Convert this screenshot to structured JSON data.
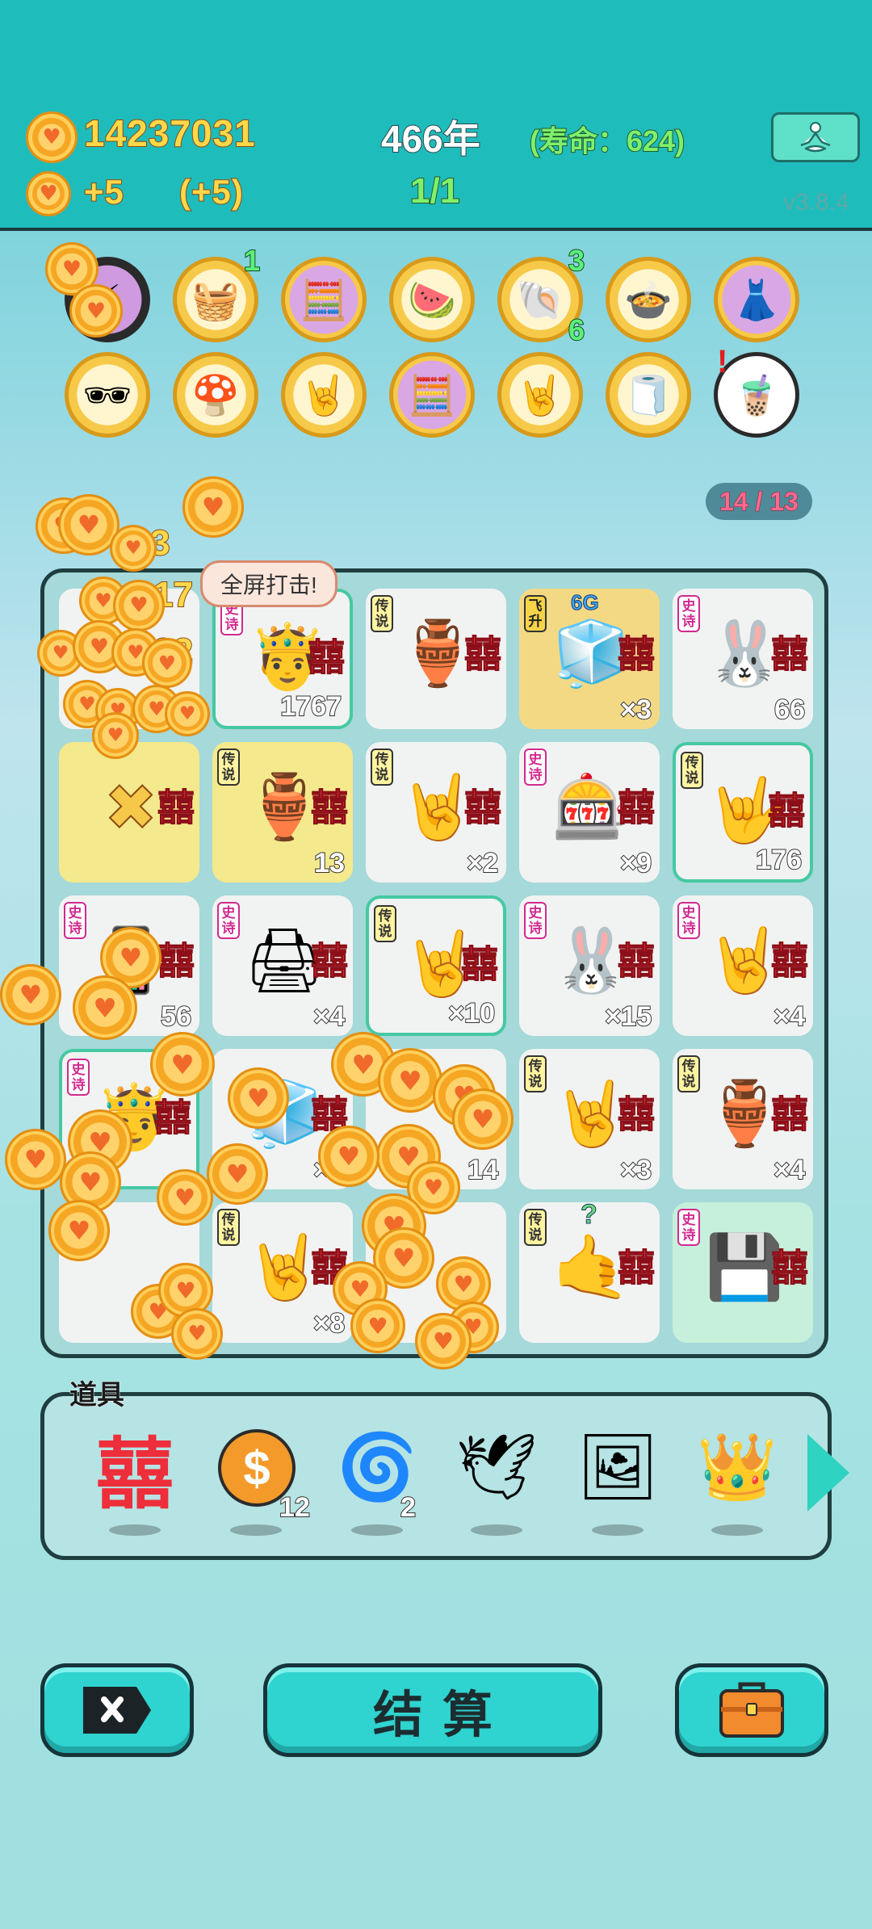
{
  "header": {
    "coins": "14237031",
    "year": "466年",
    "lifespan": "(寿命：624)",
    "income": "+5",
    "income_bonus": "(+5)",
    "round": "1/1",
    "version": "v3.8.4",
    "meditate_icon": "meditate-person-icon"
  },
  "relics": {
    "row1": [
      {
        "name": "lightning-icon",
        "glyph": "⚡"
      },
      {
        "name": "fruit-basket-icon",
        "glyph": "🧺",
        "count": "1"
      },
      {
        "name": "math-head-icon",
        "glyph": "🧮"
      },
      {
        "name": "fruit-plate-icon",
        "glyph": "🍉"
      },
      {
        "name": "shell-icon",
        "glyph": "🐚",
        "count": "3",
        "count2": "6"
      },
      {
        "name": "duck-pot-icon",
        "glyph": "🍲"
      },
      {
        "name": "skirt-icon",
        "glyph": "👗"
      }
    ],
    "row2": [
      {
        "name": "sunglasses-egg-icon",
        "glyph": "🕶"
      },
      {
        "name": "mushroom-cloud-icon",
        "glyph": "🍄"
      },
      {
        "name": "rock-hand-icon",
        "glyph": "🤘"
      },
      {
        "name": "math-head-icon",
        "glyph": "🧮"
      },
      {
        "name": "rock-hand-icon",
        "glyph": "🤘"
      },
      {
        "name": "tissue-box-icon",
        "glyph": "🧻"
      },
      {
        "name": "bubble-tea-icon",
        "glyph": "🧋",
        "alert": "!"
      }
    ]
  },
  "page_indicator": "14 / 13",
  "board": {
    "bubble": "全屏打击!",
    "float_numbers": [
      "3",
      "17",
      "22"
    ],
    "tags": {
      "shi": "史诗",
      "chuan": "传说",
      "fei": "飞升"
    },
    "xi": "囍",
    "cells": [
      {
        "name": "cell-coin-pile",
        "bg": "",
        "tag": "",
        "glyph": "",
        "count": ""
      },
      {
        "name": "cell-king-head",
        "bg": "glow",
        "tag": "shi",
        "glyph": "🤴",
        "count": "1767"
      },
      {
        "name": "cell-green-vase",
        "bg": "",
        "tag": "chuan",
        "glyph": "🏺",
        "count": ""
      },
      {
        "name": "cell-fridge",
        "bg": "gold",
        "tag": "fei",
        "glyph": "🧊",
        "count": "×3",
        "extra": "6G"
      },
      {
        "name": "cell-rabbit-house",
        "bg": "",
        "tag": "shi",
        "glyph": "🐰",
        "count": "66"
      },
      {
        "name": "cell-empty-yellow",
        "bg": "yellow",
        "tag": "",
        "glyph": "✖",
        "count": ""
      },
      {
        "name": "cell-green-vase",
        "bg": "yellow",
        "tag": "chuan",
        "glyph": "🏺",
        "count": "13"
      },
      {
        "name": "cell-yellow-hand",
        "bg": "",
        "tag": "chuan",
        "glyph": "🤘",
        "count": "×2"
      },
      {
        "name": "cell-gacha-machine",
        "bg": "",
        "tag": "shi",
        "glyph": "🎰",
        "count": "×9"
      },
      {
        "name": "cell-yellow-hand",
        "bg": "glow",
        "tag": "chuan",
        "glyph": "🤟",
        "count": "176"
      },
      {
        "name": "cell-phone",
        "bg": "",
        "tag": "shi",
        "glyph": "📱",
        "count": "56"
      },
      {
        "name": "cell-printer",
        "bg": "",
        "tag": "shi",
        "glyph": "🖨",
        "count": "×4"
      },
      {
        "name": "cell-crowned-hand",
        "bg": "glow",
        "tag": "chuan",
        "glyph": "🤘",
        "count": "×10"
      },
      {
        "name": "cell-rabbit-house",
        "bg": "",
        "tag": "shi",
        "glyph": "🐰",
        "count": "×15"
      },
      {
        "name": "cell-grey-hand",
        "bg": "",
        "tag": "shi",
        "glyph": "🤘",
        "count": "×4"
      },
      {
        "name": "cell-king-head",
        "bg": "glow",
        "tag": "shi",
        "glyph": "🤴",
        "count": ""
      },
      {
        "name": "cell-fridge",
        "bg": "",
        "tag": "",
        "glyph": "🧊",
        "count": "×5"
      },
      {
        "name": "cell-coin-pile",
        "bg": "",
        "tag": "",
        "glyph": "",
        "count": "14"
      },
      {
        "name": "cell-crowned-hand",
        "bg": "",
        "tag": "chuan",
        "glyph": "🤘",
        "count": "×3"
      },
      {
        "name": "cell-green-vase",
        "bg": "",
        "tag": "chuan",
        "glyph": "🏺",
        "count": "×4"
      },
      {
        "name": "cell-empty",
        "bg": "",
        "tag": "",
        "glyph": "",
        "count": ""
      },
      {
        "name": "cell-crowned-hand-big",
        "bg": "",
        "tag": "chuan",
        "glyph": "🤘",
        "count": "×8"
      },
      {
        "name": "cell-coin-pile",
        "bg": "",
        "tag": "",
        "glyph": "",
        "count": ""
      },
      {
        "name": "cell-yellow-hand-question",
        "bg": "",
        "tag": "chuan",
        "glyph": "🤙",
        "count": "",
        "extra": "?"
      },
      {
        "name": "cell-gpu",
        "bg": "mint",
        "tag": "shi",
        "glyph": "💾",
        "count": ""
      }
    ]
  },
  "props": {
    "label": "道具",
    "items": [
      {
        "name": "xi-character-icon",
        "glyph": "囍",
        "count": ""
      },
      {
        "name": "dollar-coin-icon",
        "glyph": "$",
        "count": "12"
      },
      {
        "name": "black-hole-icon",
        "glyph": "🌀",
        "count": "2"
      },
      {
        "name": "white-bird-icon",
        "glyph": "🕊",
        "count": ""
      },
      {
        "name": "picture-frame-icon",
        "glyph": "🖼",
        "count": ""
      },
      {
        "name": "crown-icon",
        "glyph": "👑",
        "count": ""
      }
    ]
  },
  "buttons": {
    "close_icon": "close-tag-icon",
    "settle": "结算",
    "bag_icon": "briefcase-icon"
  },
  "colors": {
    "header": "#1fbcbc",
    "button": "#2fd3cf",
    "xi": "#ee2e3a",
    "coin": "#f5a623"
  }
}
